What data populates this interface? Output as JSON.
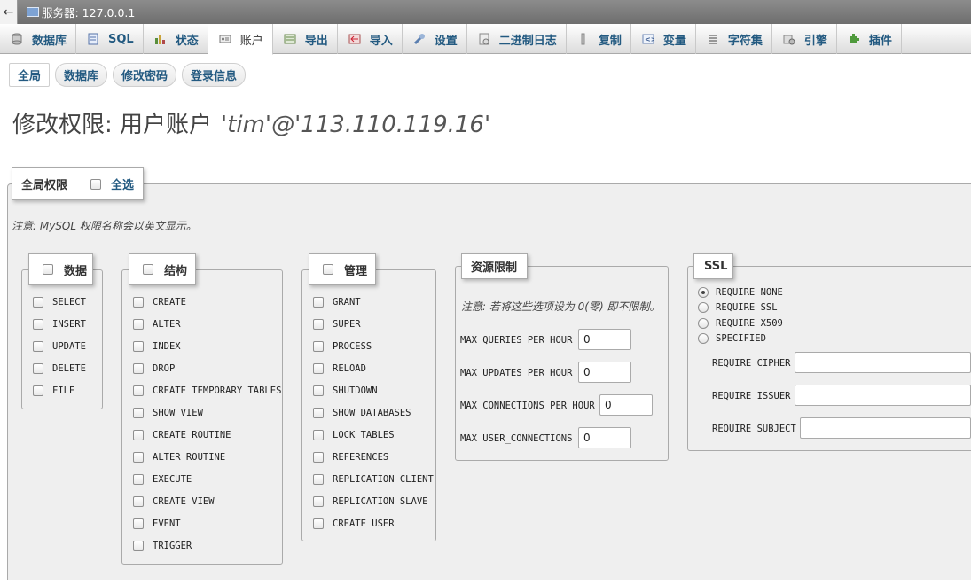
{
  "server_bar": {
    "back": "←",
    "label": "服务器: 127.0.0.1"
  },
  "tabs": [
    {
      "label": "数据库",
      "icon": "database-icon"
    },
    {
      "label": "SQL",
      "icon": "sql-icon"
    },
    {
      "label": "状态",
      "icon": "status-icon"
    },
    {
      "label": "账户",
      "icon": "users-icon",
      "active": true
    },
    {
      "label": "导出",
      "icon": "export-icon"
    },
    {
      "label": "导入",
      "icon": "import-icon"
    },
    {
      "label": "设置",
      "icon": "wrench-icon"
    },
    {
      "label": "二进制日志",
      "icon": "binlog-icon"
    },
    {
      "label": "复制",
      "icon": "replication-icon"
    },
    {
      "label": "变量",
      "icon": "variables-icon"
    },
    {
      "label": "字符集",
      "icon": "charset-icon"
    },
    {
      "label": "引擎",
      "icon": "engine-icon"
    },
    {
      "label": "插件",
      "icon": "plugin-icon"
    }
  ],
  "subtabs": [
    "全局",
    "数据库",
    "修改密码",
    "登录信息"
  ],
  "title": {
    "prefix": "修改权限:  用户账户",
    "account": "'tim'@'113.110.119.16'"
  },
  "global_legend": {
    "label": "全局权限",
    "select_all": "全选"
  },
  "note_names": "注意: MySQL 权限名称会以英文显示。",
  "groups": {
    "data": {
      "title": "数据",
      "items": [
        "SELECT",
        "INSERT",
        "UPDATE",
        "DELETE",
        "FILE"
      ]
    },
    "structure": {
      "title": "结构",
      "items": [
        "CREATE",
        "ALTER",
        "INDEX",
        "DROP",
        "CREATE TEMPORARY TABLES",
        "SHOW VIEW",
        "CREATE ROUTINE",
        "ALTER ROUTINE",
        "EXECUTE",
        "CREATE VIEW",
        "EVENT",
        "TRIGGER"
      ]
    },
    "admin": {
      "title": "管理",
      "items": [
        "GRANT",
        "SUPER",
        "PROCESS",
        "RELOAD",
        "SHUTDOWN",
        "SHOW DATABASES",
        "LOCK TABLES",
        "REFERENCES",
        "REPLICATION CLIENT",
        "REPLICATION SLAVE",
        "CREATE USER"
      ]
    }
  },
  "resources": {
    "title": "资源限制",
    "note": "注意: 若将这些选项设为 0(零) 即不限制。",
    "rows": [
      {
        "label": "MAX QUERIES PER HOUR",
        "value": "0"
      },
      {
        "label": "MAX UPDATES PER HOUR",
        "value": "0"
      },
      {
        "label": "MAX CONNECTIONS PER HOUR",
        "value": "0"
      },
      {
        "label": "MAX USER_CONNECTIONS",
        "value": "0"
      }
    ]
  },
  "ssl": {
    "title": "SSL",
    "options": [
      "REQUIRE NONE",
      "REQUIRE SSL",
      "REQUIRE X509",
      "SPECIFIED"
    ],
    "selected": "REQUIRE NONE",
    "fields": [
      {
        "label": "REQUIRE CIPHER",
        "value": ""
      },
      {
        "label": "REQUIRE ISSUER",
        "value": ""
      },
      {
        "label": "REQUIRE SUBJECT",
        "value": ""
      }
    ]
  },
  "colors": {
    "link": "#235a81",
    "panel": "#efefef",
    "topbar": "#7a7a7a"
  }
}
